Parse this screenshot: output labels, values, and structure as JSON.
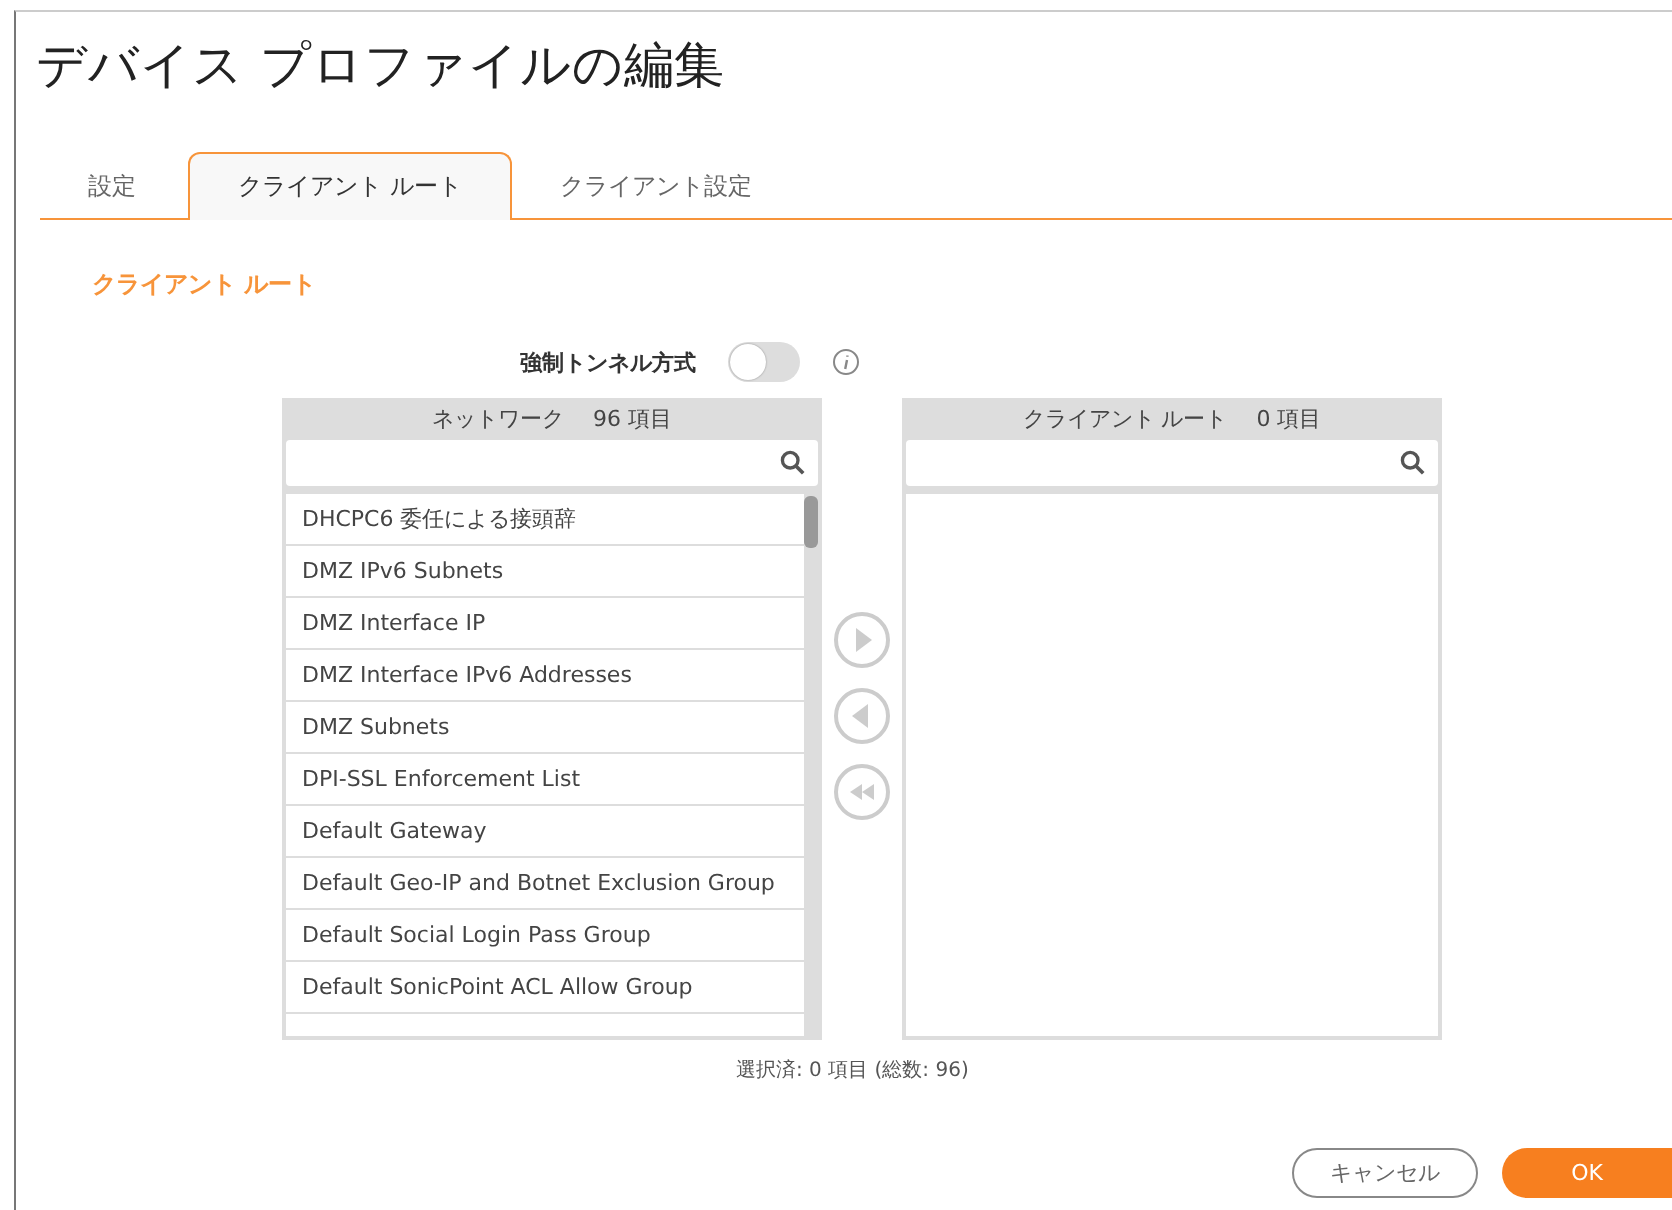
{
  "window": {
    "title": "デバイス プロファイルの編集"
  },
  "tabs": [
    {
      "label": "設定",
      "selected": false
    },
    {
      "label": "クライアント ルート",
      "selected": true
    },
    {
      "label": "クライアント設定",
      "selected": false
    }
  ],
  "section_title": "クライアント ルート",
  "tunnel_toggle": {
    "label": "強制トンネル方式",
    "on": false
  },
  "available_list": {
    "title": "ネットワーク",
    "count": "96 項目",
    "items": [
      "DHCPC6 委任による接頭辞",
      "DMZ IPv6 Subnets",
      "DMZ Interface IP",
      "DMZ Interface IPv6 Addresses",
      "DMZ Subnets",
      "DPI-SSL Enforcement List",
      "Default Gateway",
      "Default Geo-IP and Botnet Exclusion Group",
      "Default Social Login Pass Group",
      "Default SonicPoint ACL Allow Group"
    ]
  },
  "selected_list": {
    "title": "クライアント ルート",
    "count": "0 項目"
  },
  "summary": "選択済: 0 項目 (総数: 96)",
  "buttons": [
    {
      "label": "キャンセル",
      "kind": "secondary"
    },
    {
      "label": "OK",
      "kind": "primary"
    }
  ]
}
